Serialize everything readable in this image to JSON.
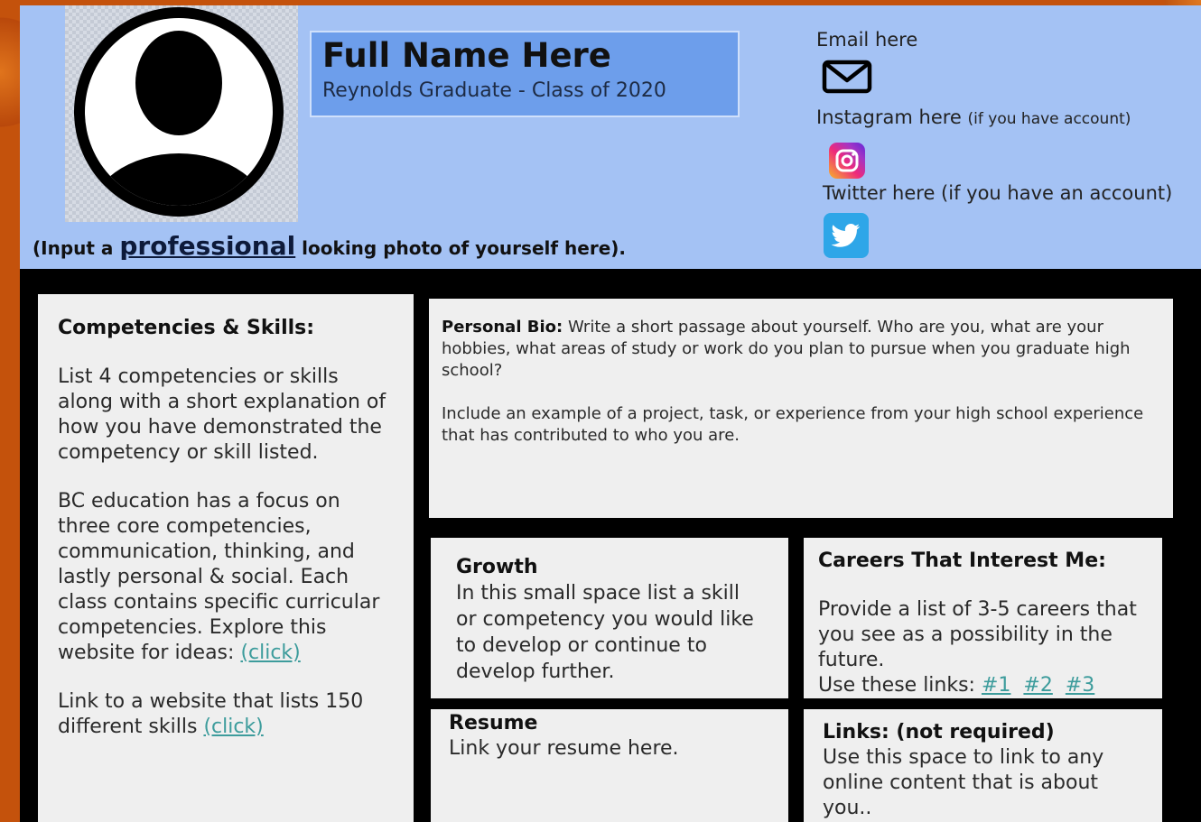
{
  "header": {
    "name": "Full Name Here",
    "subtitle": "Reynolds Graduate - Class of 2020",
    "photo_caption": {
      "before": "(Input a ",
      "emphasis": "professional",
      "after": " looking photo of yourself here)."
    },
    "email_label": "Email here",
    "instagram_label": "Instagram here",
    "instagram_note": "(if you have account)",
    "twitter_label": "Twitter here (if you have an account)"
  },
  "competencies": {
    "heading": "Competencies & Skills:",
    "para1": "List 4 competencies or skills along with a short explanation of how you have demonstrated the competency or skill listed.",
    "para2": "BC  education has a focus on three core competencies, communication, thinking, and lastly personal & social. Each class contains specific curricular competencies. Explore this website for ideas: ",
    "link1": "(click)",
    "para3": "Link to a website that lists 150 different skills ",
    "link2": "(click)"
  },
  "bio": {
    "heading": "Personal Bio:",
    "para1": " Write a short passage about yourself.  Who are you, what are your hobbies, what areas of study or work do you plan to pursue when you graduate high school?",
    "para2": "Include an example of a project, task, or experience from your high school experience that has contributed to who you are."
  },
  "growth": {
    "heading": "Growth",
    "text": "In this small space list a skill or competency you would like to develop or continue to develop further."
  },
  "careers": {
    "heading": "Careers That Interest Me:",
    "text": "Provide a list of 3-5 careers that you see as a possibility in the future.",
    "links_prefix": "Use these links: ",
    "links": [
      "#1",
      "#2",
      "#3"
    ]
  },
  "resume": {
    "heading": "Resume",
    "text": "Link your resume here."
  },
  "extra_links": {
    "heading": "Links:  (not required)",
    "text": "Use this space to link to any online content that is about you.."
  },
  "colors": {
    "header_bg": "#a4c2f4",
    "name_box_bg": "#6d9eeb",
    "panel_bg": "#efefef",
    "link": "#3d9c9c",
    "page_bg": "#c4520c"
  }
}
